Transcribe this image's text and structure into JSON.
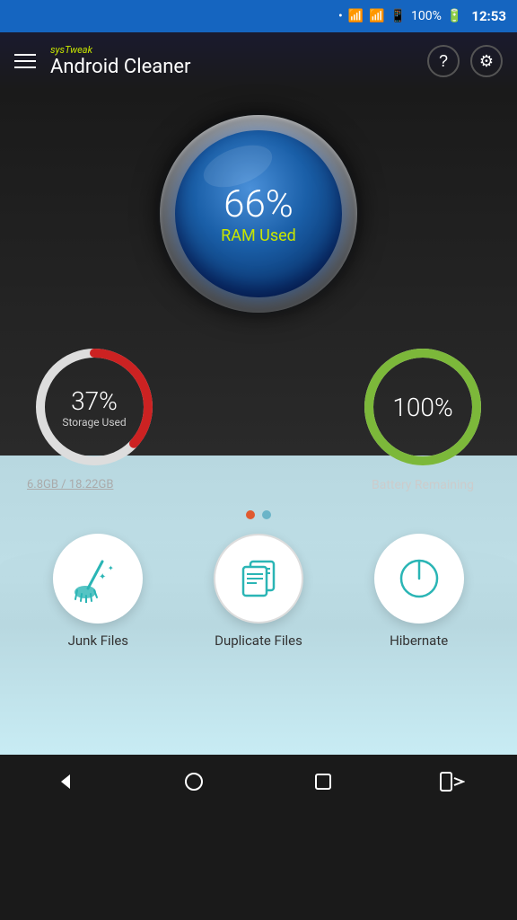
{
  "statusBar": {
    "time": "12:53",
    "battery": "100%"
  },
  "topBar": {
    "brand": "sys",
    "brandAccent": "Tweak",
    "title": "Android Cleaner"
  },
  "ram": {
    "percent": "66%",
    "label": "RAM Used"
  },
  "storage": {
    "percent": "37%",
    "label": "Storage Used",
    "detail": "6.8GB / 18.22GB",
    "trackColor": "#ddd",
    "fillColor": "#cc2222",
    "trackWidth": 10,
    "radius": 60,
    "dashArray": 377,
    "dashOffset": 238
  },
  "battery": {
    "percent": "100%",
    "label": "Battery Remaining",
    "trackColor": "#ddd",
    "fillColor": "#7cb83a",
    "trackWidth": 10,
    "radius": 60,
    "dashArray": 377,
    "dashOffset": 0
  },
  "actions": [
    {
      "id": "junk-files",
      "label": "Junk Files",
      "icon": "broom"
    },
    {
      "id": "duplicate-files",
      "label": "Duplicate Files",
      "icon": "duplicate"
    },
    {
      "id": "hibernate",
      "label": "Hibernate",
      "icon": "power"
    }
  ],
  "pageDots": [
    {
      "active": true
    },
    {
      "active": false
    }
  ]
}
